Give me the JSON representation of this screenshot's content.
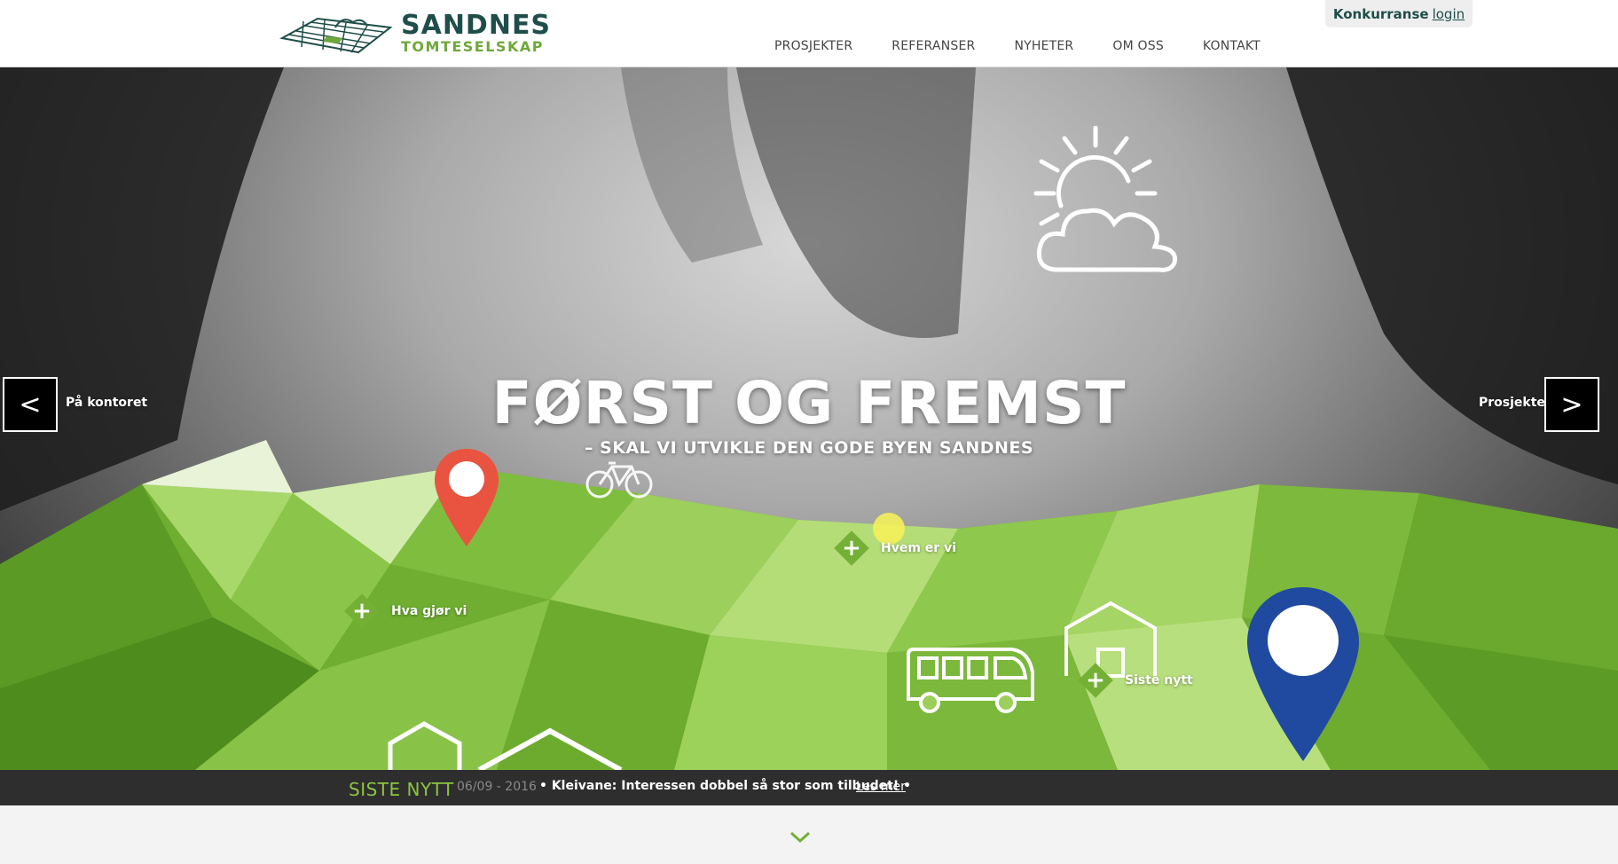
{
  "brand": {
    "name": "SANDNES",
    "tagline": "TOMTESELSKAP",
    "primary_color": "#1f4e4a",
    "accent_color": "#6fa83a"
  },
  "header": {
    "login": {
      "strong": "Konkurranse",
      "link": "login"
    },
    "nav": [
      {
        "label": "PROSJEKTER"
      },
      {
        "label": "REFERANSER"
      },
      {
        "label": "NYHETER"
      },
      {
        "label": "OM OSS"
      },
      {
        "label": "KONTAKT"
      }
    ]
  },
  "hero": {
    "title": "FØRST OG FREMST",
    "subtitle": "–  SKAL VI UTVIKLE DEN GODE BYEN SANDNES",
    "prev": {
      "symbol": "<",
      "label": "På kontoret"
    },
    "next": {
      "symbol": ">",
      "label": "Prosjekter"
    },
    "hotspots": [
      {
        "label": "Hva gjør vi"
      },
      {
        "label": "Hvem er vi"
      },
      {
        "label": "Siste nytt"
      }
    ],
    "icons": [
      "weather-sun-cloud-icon",
      "bicycle-icon",
      "bus-icon",
      "house-icon",
      "map-pin-red-icon",
      "map-pin-blue-icon"
    ],
    "pin_colors": {
      "red": "#e8543f",
      "blue": "#1f4aa0"
    }
  },
  "news": {
    "heading": "SISTE NYTT",
    "date": "06/09 - 2016",
    "headline": "• Kleivane: Interessen dobbel så stor som tilbudet! •",
    "link": "Les mer"
  }
}
